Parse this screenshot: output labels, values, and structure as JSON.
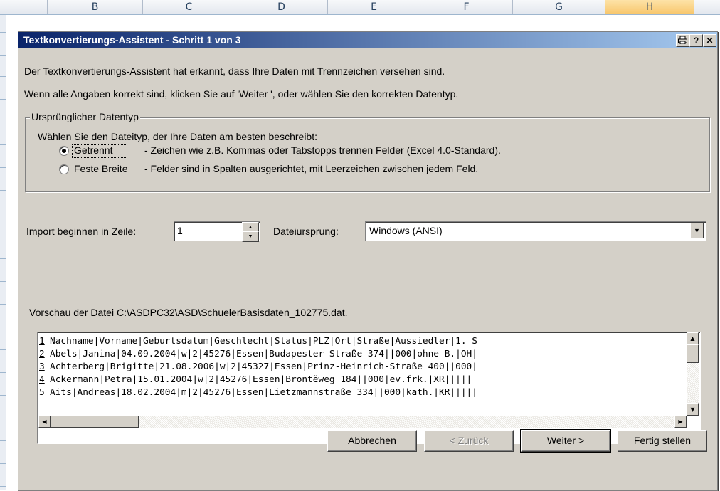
{
  "spreadsheet": {
    "columns": [
      "B",
      "C",
      "D",
      "E",
      "F",
      "G",
      "H"
    ]
  },
  "dialog": {
    "title": "Textkonvertierungs-Assistent - Schritt 1 von 3",
    "intro_line1": "Der Textkonvertierungs-Assistent hat erkannt, dass Ihre Daten mit Trennzeichen versehen sind.",
    "intro_line2": "Wenn alle Angaben korrekt sind, klicken Sie auf 'Weiter ', oder wählen Sie den korrekten Datentyp.",
    "group": {
      "label": "Ursprünglicher Datentyp",
      "prompt": "Wählen Sie den Dateityp, der Ihre Daten am besten beschreibt:",
      "options": [
        {
          "label": "Getrennt",
          "description": "- Zeichen wie z.B. Kommas oder Tabstopps trennen Felder (Excel 4.0-Standard).",
          "checked": true
        },
        {
          "label": "Feste Breite",
          "description": "- Felder sind in Spalten ausgerichtet, mit Leerzeichen zwischen jedem Feld.",
          "checked": false
        }
      ]
    },
    "import_label": "Import beginnen in Zeile:",
    "import_value": "1",
    "origin_label": "Dateiursprung:",
    "origin_value": "Windows (ANSI)",
    "preview_label": "Vorschau der Datei C:\\ASDPC32\\ASD\\SchuelerBasisdaten_102775.dat.",
    "preview_rows": [
      {
        "num": "1",
        "text": "Nachname|Vorname|Geburtsdatum|Geschlecht|Status|PLZ|Ort|Straße|Aussiedler|1. S"
      },
      {
        "num": "2",
        "text": "Abels|Janina|04.09.2004|w|2|45276|Essen|Budapester Straße 374||000|ohne B.|OH|"
      },
      {
        "num": "3",
        "text": "Achterberg|Brigitte|21.08.2006|w|2|45327|Essen|Prinz-Heinrich-Straße 400||000|"
      },
      {
        "num": "4",
        "text": "Ackermann|Petra|15.01.2004|w|2|45276|Essen|Brontëweg 184||000|ev.frk.|XR|||||"
      },
      {
        "num": "5",
        "text": "Aits|Andreas|18.02.2004|m|2|45276|Essen|Lietzmannstraße 334||000|kath.|KR|||||"
      }
    ],
    "buttons": {
      "cancel": "Abbrechen",
      "back": "< Zurück",
      "next": "Weiter >",
      "finish": "Fertig stellen"
    }
  }
}
